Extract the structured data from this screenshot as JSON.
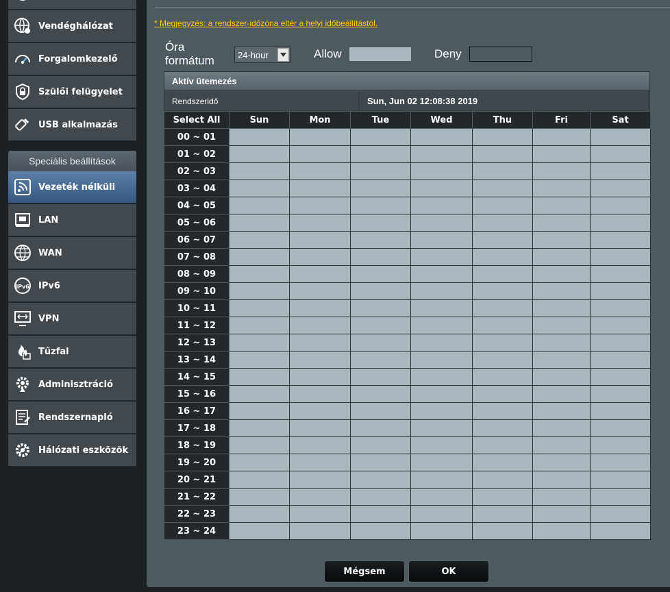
{
  "sidebar": {
    "top_items": [
      {
        "label": "Vendéghálózat",
        "icon": "globe-users-icon"
      },
      {
        "label": "Forgalomkezelő",
        "icon": "speedometer-icon"
      },
      {
        "label": "Szülői felügyelet",
        "icon": "lock-shield-icon"
      },
      {
        "label": "USB alkalmazás",
        "icon": "usb-icon"
      }
    ],
    "section_header": "Speciális beállítások",
    "items": [
      {
        "label": "Vezeték nélküli",
        "icon": "wifi-icon",
        "active": true
      },
      {
        "label": "LAN",
        "icon": "lan-icon"
      },
      {
        "label": "WAN",
        "icon": "globe-icon"
      },
      {
        "label": "IPv6",
        "icon": "ipv6-icon"
      },
      {
        "label": "VPN",
        "icon": "vpn-icon"
      },
      {
        "label": "Tűzfal",
        "icon": "firewall-icon"
      },
      {
        "label": "Adminisztráció",
        "icon": "admin-gear-icon"
      },
      {
        "label": "Rendszernapló",
        "icon": "log-icon"
      },
      {
        "label": "Hálózati eszközök",
        "icon": "tools-gear-icon"
      }
    ]
  },
  "main": {
    "note": "* Megjegyzés: a rendszer-időzóna eltér a helyi időbeállítástól.",
    "time_format_label": "Óra formátum",
    "time_format_value": "24-hour",
    "allow_label": "Allow",
    "deny_label": "Deny",
    "schedule_title": "Aktív ütemezés",
    "system_time_label": "Rendszeridő",
    "system_time_value": "Sun, Jun 02 12:08:38 2019",
    "select_all": "Select All",
    "days": [
      "Sun",
      "Mon",
      "Tue",
      "Wed",
      "Thu",
      "Fri",
      "Sat"
    ],
    "hours": [
      "00 ~ 01",
      "01 ~ 02",
      "02 ~ 03",
      "03 ~ 04",
      "04 ~ 05",
      "05 ~ 06",
      "06 ~ 07",
      "07 ~ 08",
      "08 ~ 09",
      "09 ~ 10",
      "10 ~ 11",
      "11 ~ 12",
      "12 ~ 13",
      "13 ~ 14",
      "14 ~ 15",
      "15 ~ 16",
      "16 ~ 17",
      "17 ~ 18",
      "18 ~ 19",
      "19 ~ 20",
      "20 ~ 21",
      "21 ~ 22",
      "22 ~ 23",
      "23 ~ 24"
    ],
    "cell_state": "allow",
    "cancel_label": "Mégsem",
    "ok_label": "OK"
  },
  "colors": {
    "allow": "#a9b8be",
    "deny": "#4d5a5f",
    "note": "#ffcc00",
    "active_nav": "#4a6d94"
  }
}
